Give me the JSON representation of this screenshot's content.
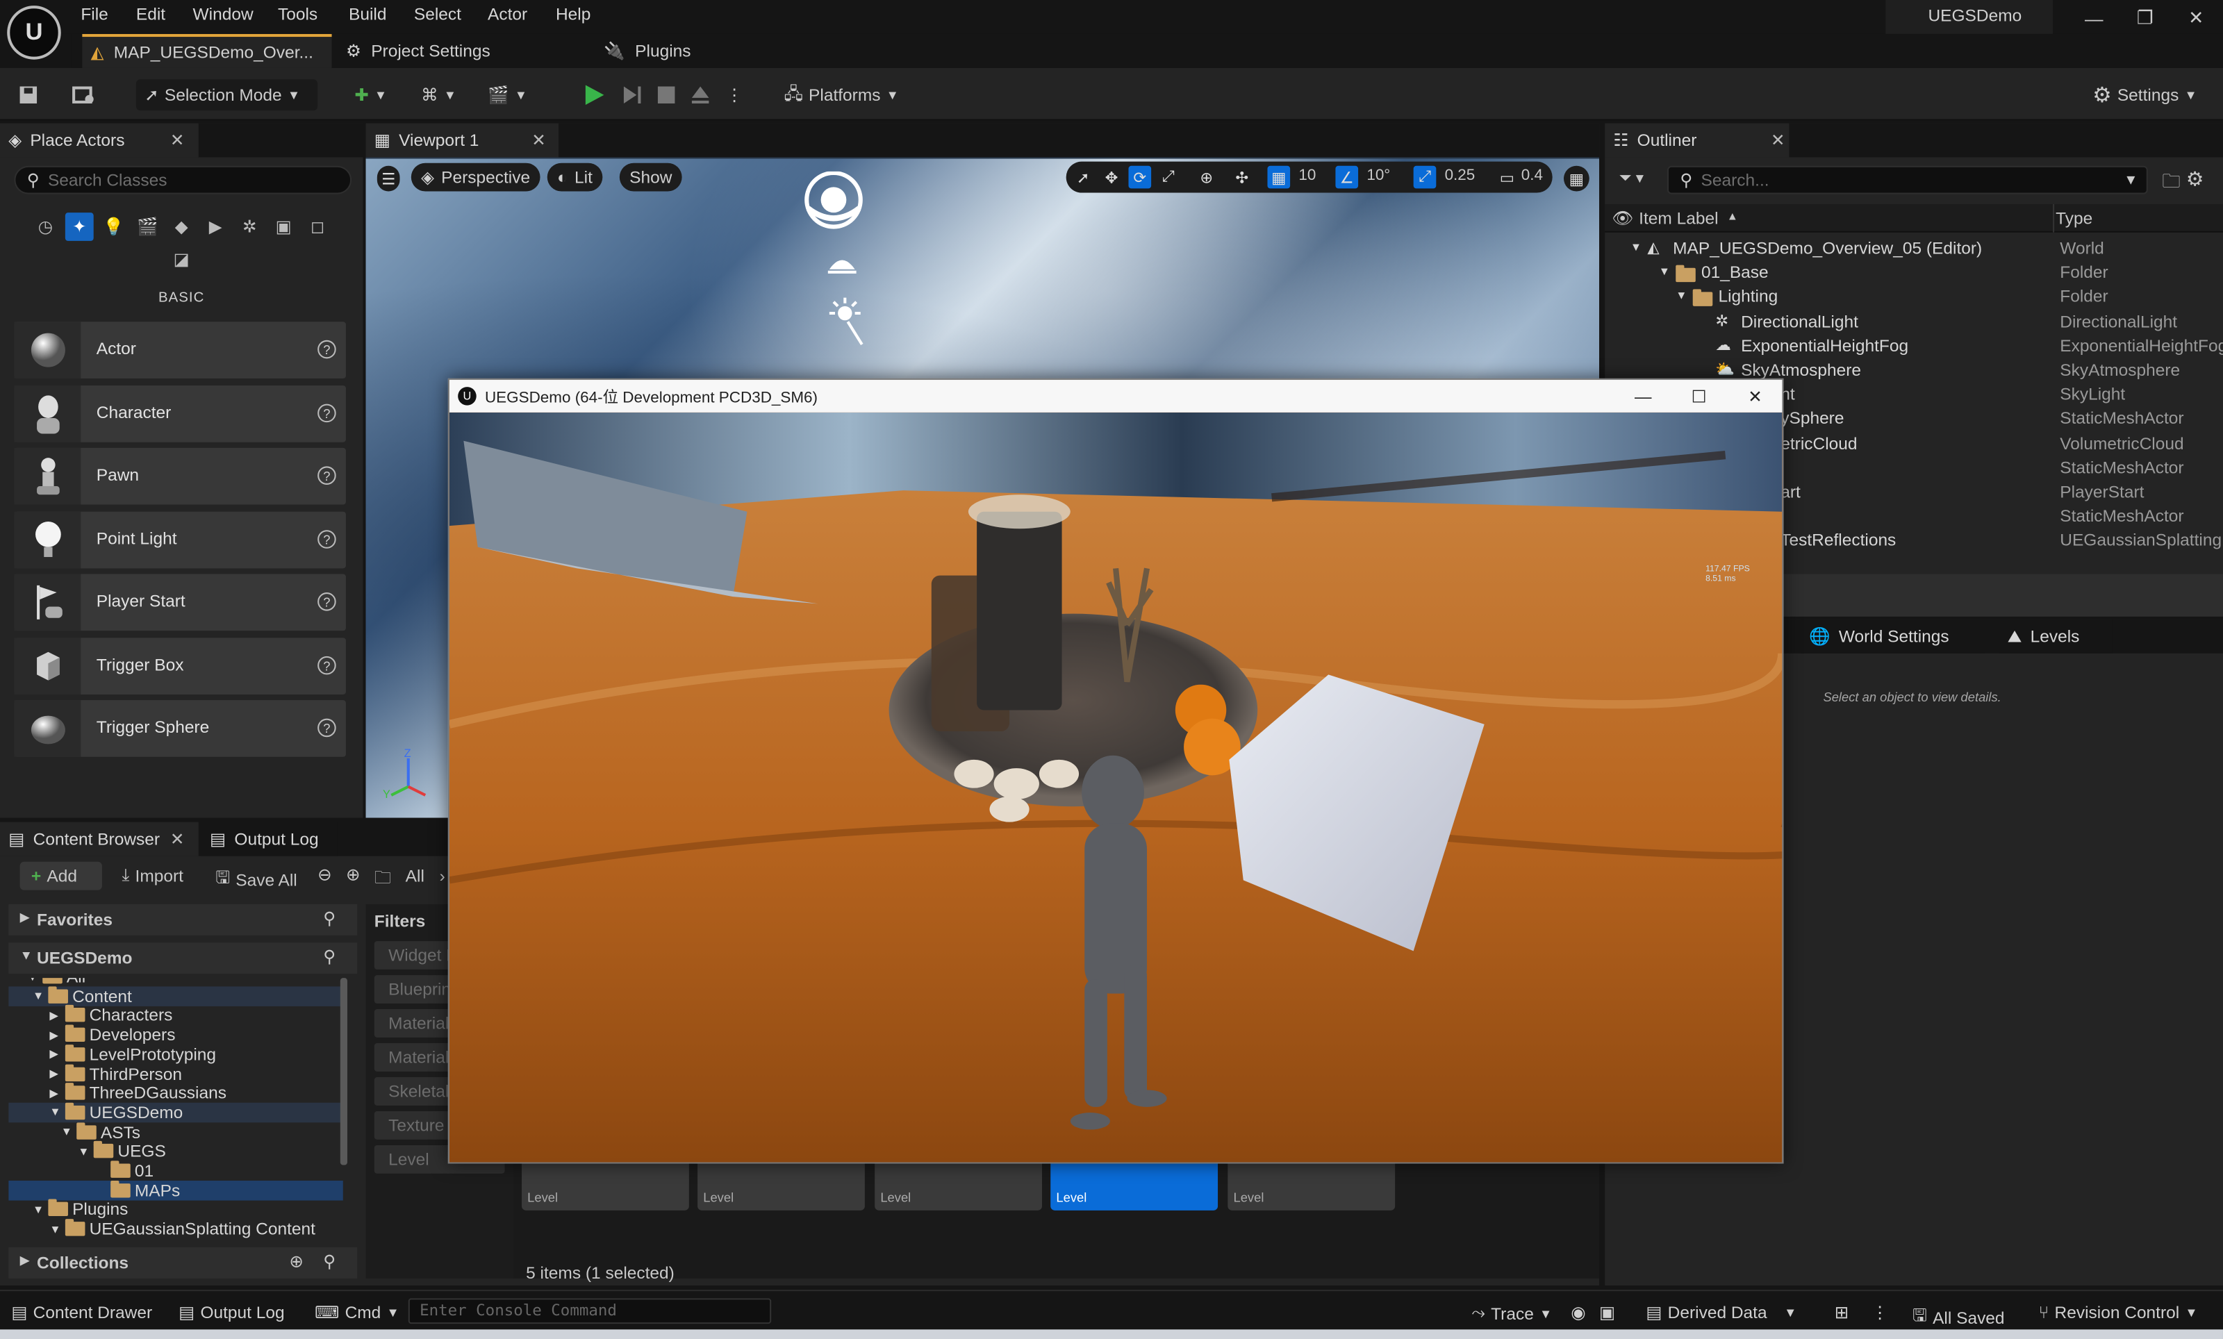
{
  "app": {
    "logo": "U",
    "project_name": "UEGSDemo"
  },
  "menu": [
    "File",
    "Edit",
    "Window",
    "Tools",
    "Build",
    "Select",
    "Actor",
    "Help"
  ],
  "tabs": {
    "map": "MAP_UEGSDemo_Over...",
    "project_settings": "Project Settings",
    "plugins": "Plugins"
  },
  "toolbar": {
    "selection_mode": "Selection Mode",
    "platforms": "Platforms",
    "settings": "Settings"
  },
  "place_actors": {
    "tab": "Place Actors",
    "search_placeholder": "Search Classes",
    "category": "BASIC",
    "items": [
      {
        "label": "Actor",
        "icon": "sphere-icon"
      },
      {
        "label": "Character",
        "icon": "character-icon"
      },
      {
        "label": "Pawn",
        "icon": "pawn-icon"
      },
      {
        "label": "Point Light",
        "icon": "bulb-icon"
      },
      {
        "label": "Player Start",
        "icon": "player-start-icon"
      },
      {
        "label": "Trigger Box",
        "icon": "box-icon"
      },
      {
        "label": "Trigger Sphere",
        "icon": "sphere-icon"
      }
    ]
  },
  "viewport": {
    "tab": "Viewport 1",
    "perspective": "Perspective",
    "lit": "Lit",
    "show": "Show",
    "grid_snap": "10",
    "rot_snap": "10°",
    "scale_snap": "0.25",
    "cam_speed": "0.4"
  },
  "game_window": {
    "title": "UEGSDemo   (64-位 Development PCD3D_SM6)",
    "fps": "117.47 FPS",
    "ms": "8.51 ms"
  },
  "outliner": {
    "tab": "Outliner",
    "search_placeholder": "Search...",
    "col_label": "Item Label",
    "col_type": "Type",
    "rows": [
      {
        "name": "MAP_UEGSDemo_Overview_05 (Editor)",
        "type": "World"
      },
      {
        "name": "01_Base",
        "type": "Folder"
      },
      {
        "name": "Lighting",
        "type": "Folder"
      },
      {
        "name": "DirectionalLight",
        "type": "DirectionalLight"
      },
      {
        "name": "ExponentialHeightFog",
        "type": "ExponentialHeightFog"
      },
      {
        "name": "SkyAtmosphere",
        "type": "SkyAtmosphere"
      },
      {
        "name": "nt",
        "type": "SkyLight"
      },
      {
        "name": "ySphere",
        "type": "StaticMeshActor"
      },
      {
        "name": "etricCloud",
        "type": "VolumetricCloud"
      },
      {
        "name": "",
        "type": "StaticMeshActor"
      },
      {
        "name": "art",
        "type": "PlayerStart"
      },
      {
        "name": "",
        "type": "StaticMeshActor"
      },
      {
        "name": "TestReflections",
        "type": "UEGaussianSplatting"
      }
    ]
  },
  "details": {
    "world_settings": "World Settings",
    "levels": "Levels",
    "empty_msg": "Select an object to view details."
  },
  "content_browser": {
    "tab": "Content Browser",
    "output_tab": "Output Log",
    "add": "Add",
    "import": "Import",
    "save_all": "Save All",
    "path": "All",
    "favorites": "Favorites",
    "root": "UEGSDemo",
    "filters": "Filters",
    "collections": "Collections",
    "tree": [
      "All",
      "Content",
      "Characters",
      "Developers",
      "LevelPrototyping",
      "ThirdPerson",
      "ThreeDGaussians",
      "UEGSDemo",
      "ASTs",
      "UEGS",
      "01",
      "MAPs",
      "Plugins",
      "UEGaussianSplatting Content"
    ],
    "filter_items": [
      "Widget B",
      "Blueprin",
      "Material",
      "Material",
      "Skeletal",
      "Texture",
      "Level"
    ],
    "assets": [
      "Level",
      "Level",
      "Level",
      "Level",
      "Level"
    ],
    "status": "5 items (1 selected)"
  },
  "statusbar": {
    "content_drawer": "Content Drawer",
    "output_log": "Output Log",
    "cmd": "Cmd",
    "console_placeholder": "Enter Console Command",
    "trace": "Trace",
    "derived_data": "Derived Data",
    "all_saved": "All Saved",
    "revision_control": "Revision Control"
  },
  "colors": {
    "accent": "#e1a43a",
    "play": "#39b54a",
    "selection": "#0a6cd8",
    "panel": "#242424",
    "bg": "#151515"
  }
}
